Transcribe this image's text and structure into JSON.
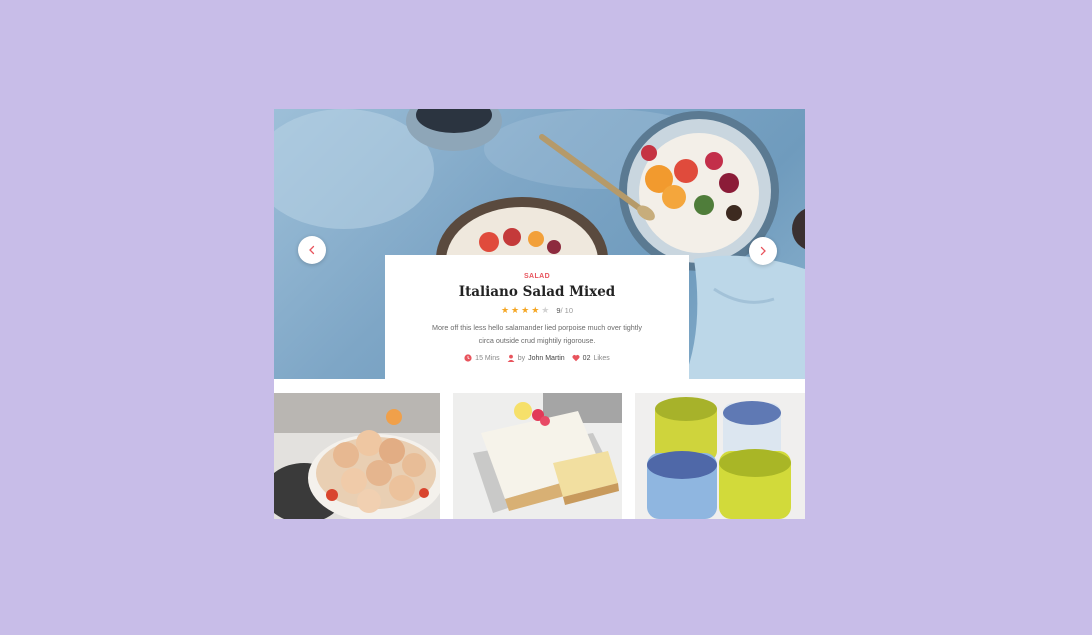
{
  "slide": {
    "category": "SALAD",
    "title": "Italiano Salad Mixed",
    "rating": {
      "stars_filled": 4,
      "stars_total": 5,
      "score": "9",
      "max": "/ 10"
    },
    "description": "More off this less hello salamander lied porpoise much over tightly circa outside crud mightily rigorouse.",
    "meta": {
      "time": "15 Mins",
      "author_prefix": "by",
      "author": "John Martin",
      "likes_count": "02",
      "likes_label": "Likes"
    }
  },
  "navigation": {
    "prev_icon": "chevron-left-icon",
    "next_icon": "chevron-right-icon"
  },
  "thumbnails": [
    {
      "image": "macarons-bowl-image"
    },
    {
      "image": "glazed-loaf-cake-image"
    },
    {
      "image": "smoothie-glasses-image"
    }
  ],
  "colors": {
    "background": "#c8bde8",
    "accent": "#e8545d",
    "star": "#f5a623"
  }
}
